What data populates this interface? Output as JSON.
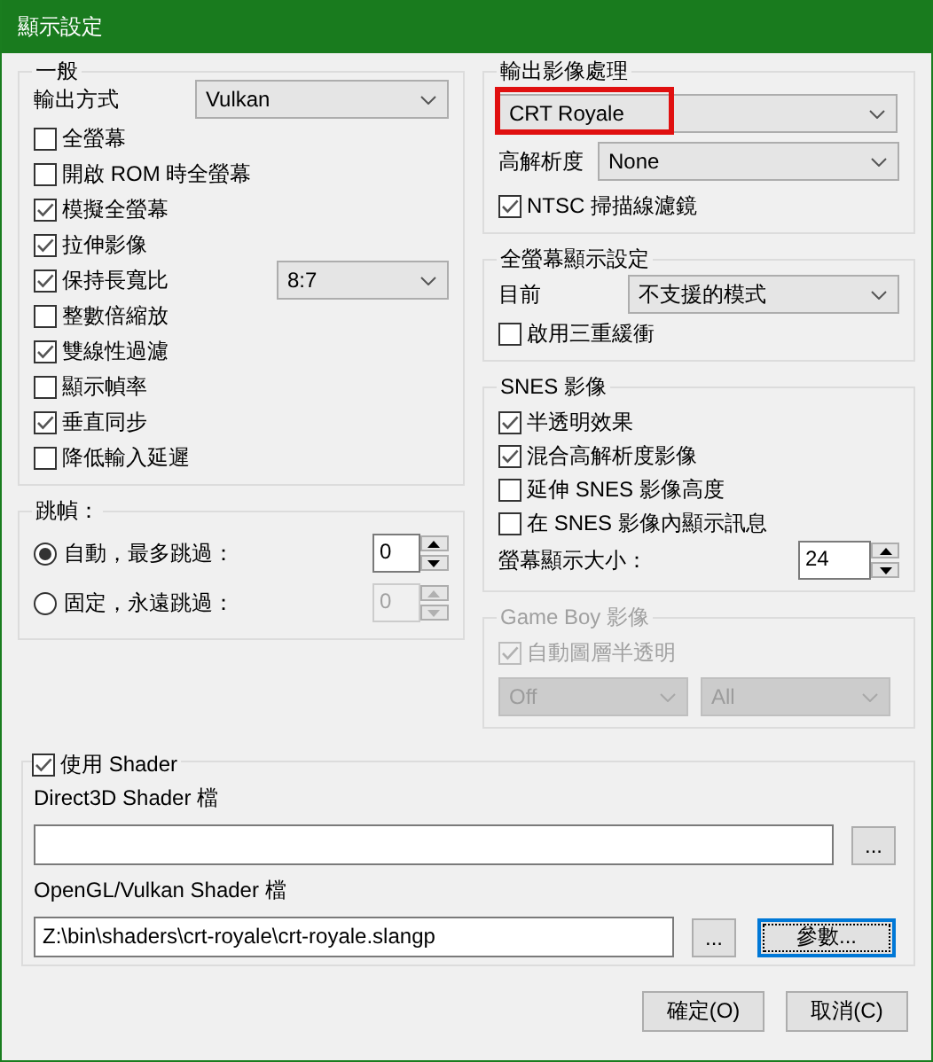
{
  "window": {
    "title": "顯示設定"
  },
  "general": {
    "title": "一般",
    "output_label": "輸出方式",
    "output_value": "Vulkan",
    "options": [
      {
        "label": "全螢幕",
        "checked": false
      },
      {
        "label": "開啟 ROM 時全螢幕",
        "checked": false
      },
      {
        "label": "模擬全螢幕",
        "checked": true
      },
      {
        "label": "拉伸影像",
        "checked": true
      },
      {
        "label": "保持長寬比",
        "checked": true,
        "dropdown": "8:7"
      },
      {
        "label": "整數倍縮放",
        "checked": false
      },
      {
        "label": "雙線性過濾",
        "checked": true
      },
      {
        "label": "顯示幀率",
        "checked": false
      },
      {
        "label": "垂直同步",
        "checked": true
      },
      {
        "label": "降低輸入延遲",
        "checked": false
      }
    ]
  },
  "frame_skip": {
    "title": "跳幀：",
    "options": [
      {
        "label": "自動，最多跳過：",
        "selected": true,
        "value": "0",
        "disabled": false
      },
      {
        "label": "固定，永遠跳過：",
        "selected": false,
        "value": "0",
        "disabled": true
      }
    ]
  },
  "output_processing": {
    "title": "輸出影像處理",
    "filter": {
      "value": "CRT Royale",
      "highlighted": true
    },
    "hires_label": "高解析度",
    "hires_value": "None",
    "ntsc": {
      "label": "NTSC 掃描線濾鏡",
      "checked": true
    }
  },
  "fullscreen": {
    "title": "全螢幕顯示設定",
    "current_label": "目前",
    "current_value": "不支援的模式",
    "triple_buffer": {
      "label": "啟用三重緩衝",
      "checked": false
    }
  },
  "snes": {
    "title": "SNES 影像",
    "options": [
      {
        "label": "半透明效果",
        "checked": true
      },
      {
        "label": "混合高解析度影像",
        "checked": true
      },
      {
        "label": "延伸 SNES 影像高度",
        "checked": false
      },
      {
        "label": "在 SNES 影像內顯示訊息",
        "checked": false
      }
    ],
    "osd_label": "螢幕顯示大小：",
    "osd_value": "24"
  },
  "gameboy": {
    "title": "Game Boy 影像",
    "disabled": true,
    "blend": {
      "label": "自動圖層半透明",
      "checked": true
    },
    "dropdowns": [
      "Off",
      "All"
    ]
  },
  "shader": {
    "enabled": {
      "label": "使用 Shader",
      "checked": true
    },
    "d3d_label": "Direct3D Shader 檔",
    "d3d_browse": "...",
    "gl_label": "OpenGL/Vulkan Shader 檔",
    "gl_path": "Z:\\bin\\shaders\\crt-royale\\crt-royale.slangp",
    "gl_browse": "...",
    "params": {
      "label": "參數...",
      "focused": true
    }
  },
  "buttons": [
    {
      "label": "確定(O)"
    },
    {
      "label": "取消(C)"
    }
  ]
}
